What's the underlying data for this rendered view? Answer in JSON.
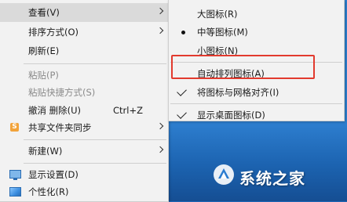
{
  "main_menu": {
    "items": [
      {
        "label": "查看(V)",
        "shortcut": "",
        "has_arrow": true,
        "disabled": false,
        "hover": true
      },
      {
        "label": "排序方式(O)",
        "shortcut": "",
        "has_arrow": true,
        "disabled": false,
        "hover": false
      },
      {
        "label": "刷新(E)",
        "shortcut": "",
        "has_arrow": false,
        "disabled": false,
        "hover": false
      },
      {
        "label": "粘贴(P)",
        "shortcut": "",
        "has_arrow": false,
        "disabled": true,
        "hover": false
      },
      {
        "label": "粘贴快捷方式(S)",
        "shortcut": "",
        "has_arrow": false,
        "disabled": true,
        "hover": false
      },
      {
        "label": "撤消 删除(U)",
        "shortcut": "Ctrl+Z",
        "has_arrow": false,
        "disabled": false,
        "hover": false
      },
      {
        "label": "共享文件夹同步",
        "shortcut": "",
        "has_arrow": true,
        "disabled": false,
        "hover": false,
        "icon": "share-sync-icon"
      },
      {
        "label": "新建(W)",
        "shortcut": "",
        "has_arrow": true,
        "disabled": false,
        "hover": false
      },
      {
        "label": "显示设置(D)",
        "shortcut": "",
        "has_arrow": false,
        "disabled": false,
        "hover": false,
        "icon": "display-settings-icon"
      },
      {
        "label": "个性化(R)",
        "shortcut": "",
        "has_arrow": false,
        "disabled": false,
        "hover": false,
        "icon": "personalize-icon"
      }
    ]
  },
  "view_submenu": {
    "items": [
      {
        "label": "大图标(R)",
        "mark": "none"
      },
      {
        "label": "中等图标(M)",
        "mark": "bullet"
      },
      {
        "label": "小图标(N)",
        "mark": "none"
      },
      {
        "label": "自动排列图标(A)",
        "mark": "none",
        "highlighted": true
      },
      {
        "label": "将图标与网格对齐(I)",
        "mark": "check"
      },
      {
        "label": "显示桌面图标(D)",
        "mark": "check"
      }
    ]
  },
  "annotation": {
    "highlight_color": "#e23a2e"
  },
  "watermark": {
    "text": "系统之家"
  }
}
